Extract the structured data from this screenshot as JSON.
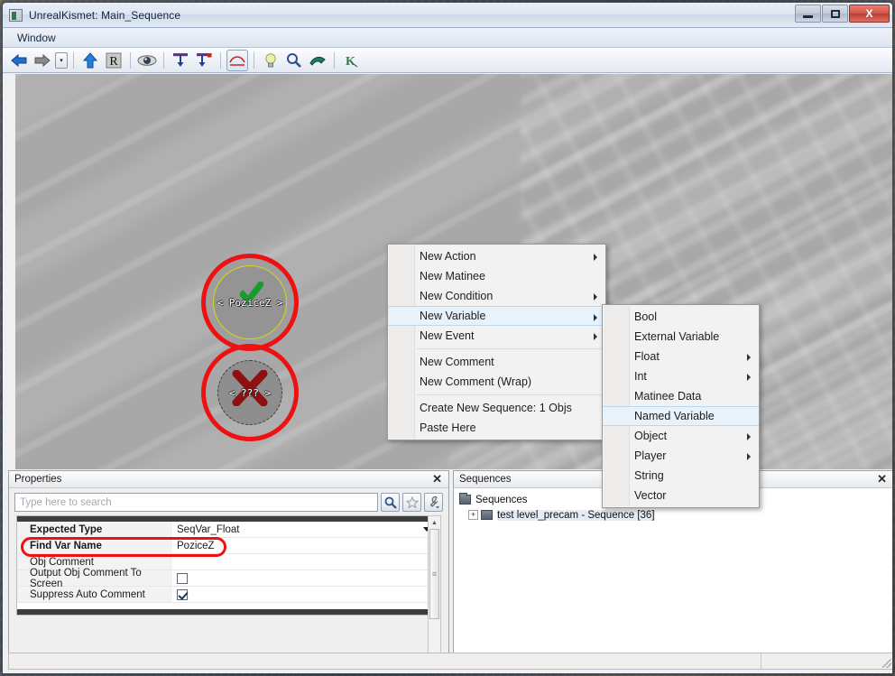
{
  "window": {
    "title": "UnrealKismet: Main_Sequence",
    "icon": "app-icon",
    "minimize_label": "–",
    "maximize_label": "□",
    "close_label": "X"
  },
  "menubar": {
    "items": [
      {
        "label": "Window",
        "name": "menu-window"
      }
    ]
  },
  "toolbar": {
    "buttons": [
      {
        "name": "back-icon",
        "glyph": "←",
        "title": "Back"
      },
      {
        "name": "forward-icon",
        "glyph": "→",
        "title": "Forward"
      },
      {
        "name": "history-dropdown-icon",
        "glyph": "▾",
        "title": "History"
      },
      {
        "name": "parent-sequence-icon",
        "glyph": "↑",
        "title": "Parent Sequence"
      },
      {
        "name": "rename-icon",
        "glyph": "R",
        "title": "Rename"
      },
      {
        "name": "hide-connectors-icon",
        "glyph": "eye",
        "title": "Hide Connectors"
      },
      {
        "name": "show-inputs-icon",
        "glyph": "T",
        "title": "Show Inputs"
      },
      {
        "name": "show-outputs-icon",
        "glyph": "T",
        "title": "Show Outputs"
      },
      {
        "name": "curves-icon",
        "glyph": "curve",
        "title": "Curved Connections"
      },
      {
        "name": "bulb-icon",
        "glyph": "bulb",
        "title": "Tooltips"
      },
      {
        "name": "search-icon",
        "glyph": "search",
        "title": "Search"
      },
      {
        "name": "clear-icon",
        "glyph": "clear",
        "title": "Clear"
      },
      {
        "name": "kismet-icon",
        "glyph": "K",
        "title": "Kismet"
      }
    ]
  },
  "canvas": {
    "nodes": [
      {
        "name": "node-named-variable-poziceZ",
        "label": "< PoziceZ >",
        "status": "check",
        "annotated": true
      },
      {
        "name": "node-unknown-variable",
        "label": "< ??? >",
        "status": "cross",
        "annotated": true
      }
    ]
  },
  "context_menu": {
    "items": [
      {
        "label": "New Action",
        "submenu": true,
        "highlight": false,
        "sep_after": false
      },
      {
        "label": "New Matinee",
        "submenu": false,
        "highlight": false,
        "sep_after": false
      },
      {
        "label": "New Condition",
        "submenu": true,
        "highlight": false,
        "sep_after": false
      },
      {
        "label": "New Variable",
        "submenu": true,
        "highlight": true,
        "sep_after": false
      },
      {
        "label": "New Event",
        "submenu": true,
        "highlight": false,
        "sep_after": true
      },
      {
        "label": "New Comment",
        "submenu": false,
        "highlight": false,
        "sep_after": false
      },
      {
        "label": "New Comment (Wrap)",
        "submenu": false,
        "highlight": false,
        "sep_after": true
      },
      {
        "label": "Create New Sequence: 1 Objs",
        "submenu": false,
        "highlight": false,
        "sep_after": false
      },
      {
        "label": "Paste Here",
        "submenu": false,
        "highlight": false,
        "sep_after": false
      }
    ]
  },
  "context_submenu": {
    "items": [
      {
        "label": "Bool",
        "submenu": false,
        "highlight": false
      },
      {
        "label": "External Variable",
        "submenu": false,
        "highlight": false
      },
      {
        "label": "Float",
        "submenu": true,
        "highlight": false
      },
      {
        "label": "Int",
        "submenu": true,
        "highlight": false
      },
      {
        "label": "Matinee Data",
        "submenu": false,
        "highlight": false
      },
      {
        "label": "Named Variable",
        "submenu": false,
        "highlight": true
      },
      {
        "label": "Object",
        "submenu": true,
        "highlight": false
      },
      {
        "label": "Player",
        "submenu": true,
        "highlight": false
      },
      {
        "label": "String",
        "submenu": false,
        "highlight": false
      },
      {
        "label": "Vector",
        "submenu": false,
        "highlight": false
      }
    ]
  },
  "properties_panel": {
    "caption": "Properties",
    "close_label": "✕",
    "search_placeholder": "Type here to search",
    "search_value": "",
    "search_buttons": [
      {
        "name": "search-icon",
        "glyph": "🔍"
      },
      {
        "name": "favorites-star-icon",
        "glyph": "☆"
      },
      {
        "name": "settings-wrench-icon",
        "glyph": "🔧"
      }
    ],
    "rows": [
      {
        "name": "Expected Type",
        "value": "SeqVar_Float",
        "type": "dropdown",
        "bold": true,
        "annotated": false
      },
      {
        "name": "Find Var Name",
        "value": "PoziceZ",
        "type": "text",
        "bold": true,
        "annotated": true
      },
      {
        "name": "Obj Comment",
        "value": "",
        "type": "text",
        "bold": false,
        "annotated": false
      },
      {
        "name": "Output Obj Comment To Screen",
        "value": false,
        "type": "checkbox",
        "bold": false,
        "annotated": false
      },
      {
        "name": "Suppress Auto Comment",
        "value": true,
        "type": "checkbox",
        "bold": false,
        "annotated": false
      }
    ]
  },
  "sequences_panel": {
    "caption": "Sequences",
    "close_label": "✕",
    "tree": [
      {
        "label": "Sequences",
        "level": 0,
        "expander": "",
        "selected": false
      },
      {
        "label": "test level_precam - Sequence [36]",
        "level": 1,
        "expander": "+",
        "selected": true
      }
    ]
  },
  "colors": {
    "annotation_red": "#ef1111",
    "node_highlight_yellow": "#d8d80f",
    "check_green": "#179c2e",
    "cross_dark_red": "#8e1010",
    "canvas_gray": "#a8a8a8",
    "menu_highlight": "#e8f2fb"
  },
  "statusbar": {
    "left_text": "",
    "right_text": ""
  }
}
